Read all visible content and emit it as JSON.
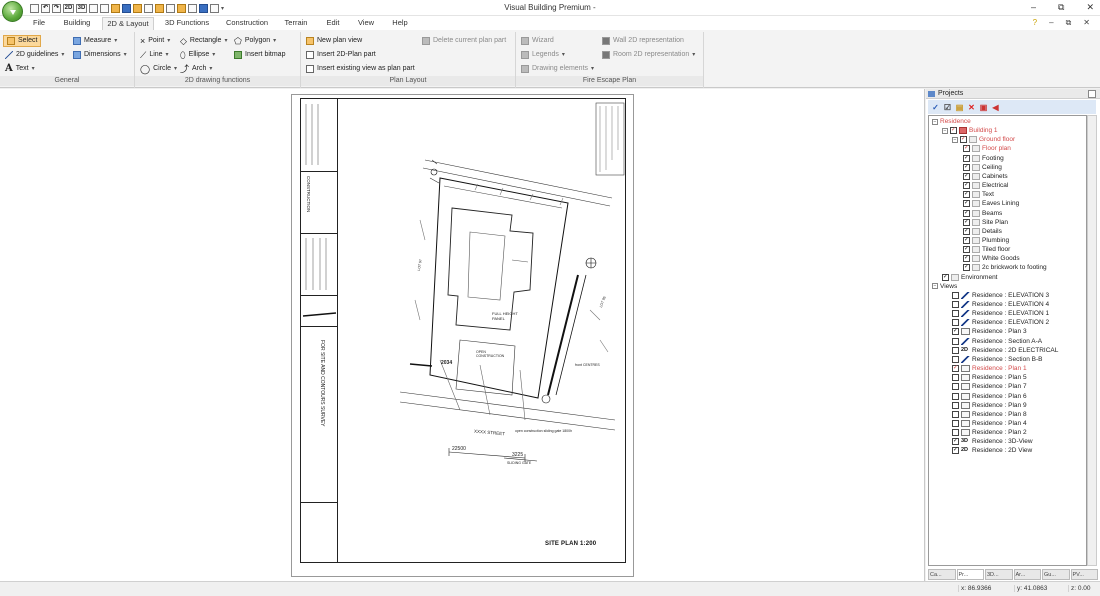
{
  "window": {
    "title": "Visual Building Premium -",
    "controls": [
      "–",
      "⧉",
      "✕"
    ]
  },
  "quick_access": [
    "2D",
    "3D"
  ],
  "menu": {
    "tabs": [
      "File",
      "Building",
      "2D & Layout",
      "3D Functions",
      "Construction",
      "Terrain",
      "Edit",
      "View",
      "Help"
    ],
    "active": "2D & Layout",
    "right_icons": [
      "?",
      "–",
      "⧉",
      "✕"
    ]
  },
  "ribbon": {
    "general": {
      "label": "General",
      "select": "Select",
      "guidelines": "2D guidelines",
      "text": "Text",
      "measure": "Measure",
      "dimensions": "Dimensions"
    },
    "drawing": {
      "label": "2D drawing functions",
      "point": "Point",
      "line": "Line",
      "circle": "Circle",
      "rectangle": "Rectangle",
      "ellipse": "Ellipse",
      "arch": "Arch",
      "polygon": "Polygon",
      "insert_bitmap": "Insert bitmap"
    },
    "plan_layout": {
      "label": "Plan Layout",
      "new_plan_view": "New plan view",
      "insert_2d_plan_part": "Insert 2D-Plan part",
      "insert_existing_view": "Insert existing view as plan part",
      "delete_current_plan_part": "Delete current plan part"
    },
    "fire_escape": {
      "label": "Fire Escape Plan",
      "wizard": "Wizard",
      "legends": "Legends",
      "drawing_elements": "Drawing elements",
      "wall_2d": "Wall 2D representation",
      "room_2d": "Room 2D representation"
    }
  },
  "drawing": {
    "site_plan_label": "SITE PLAN 1:200",
    "sidebar_text": "CONSTRUCTION",
    "contours_text": "FOR SITE AND CONTOURS SURVEY",
    "annotations": [
      "FULL HEIGHT PANEL",
      "OPEN CONSTRUCTION",
      "2034",
      "XXXX STREET",
      "22500",
      "3225",
      "SLIDING GATE",
      "open construction sliding gate 1800h",
      "front CENTRES",
      "LOT 97",
      "LOT 95"
    ]
  },
  "projects": {
    "title": "Projects",
    "tree": [
      {
        "level": 0,
        "label": "Residence",
        "expander": "minus",
        "checkbox": false,
        "red": true
      },
      {
        "level": 1,
        "label": "Building 1",
        "expander": "minus",
        "checkbox": true,
        "red": true
      },
      {
        "level": 2,
        "label": "Ground floor",
        "expander": "minus",
        "checkbox": true,
        "red": true
      },
      {
        "level": 3,
        "label": "Floor plan",
        "checkbox": true,
        "red": true
      },
      {
        "level": 3,
        "label": "Footing",
        "checkbox": true
      },
      {
        "level": 3,
        "label": "Ceiling",
        "checkbox": true
      },
      {
        "level": 3,
        "label": "Cabinets",
        "checkbox": true
      },
      {
        "level": 3,
        "label": "Electrical",
        "checkbox": true
      },
      {
        "level": 3,
        "label": "Text",
        "checkbox": true
      },
      {
        "level": 3,
        "label": "Eaves Lining",
        "checkbox": true
      },
      {
        "level": 3,
        "label": "Beams",
        "checkbox": true
      },
      {
        "level": 3,
        "label": "Site Plan",
        "checkbox": true
      },
      {
        "level": 3,
        "label": "Details",
        "checkbox": true
      },
      {
        "level": 3,
        "label": "Plumbing",
        "checkbox": true
      },
      {
        "level": 3,
        "label": "Tiled floor",
        "checkbox": true
      },
      {
        "level": 3,
        "label": "White Goods",
        "checkbox": true
      },
      {
        "level": 3,
        "label": "2c brickwork to footing",
        "checkbox": true
      },
      {
        "level": 1,
        "label": "Environment",
        "checkbox": true
      },
      {
        "level": 0,
        "label": "Views",
        "expander": "minus",
        "checkbox": false
      },
      {
        "level": 2,
        "label": "Residence : ELEVATION 3",
        "checkbox": false,
        "view": "el"
      },
      {
        "level": 2,
        "label": "Residence : ELEVATION 4",
        "checkbox": false,
        "view": "el"
      },
      {
        "level": 2,
        "label": "Residence : ELEVATION 1",
        "checkbox": false,
        "view": "el"
      },
      {
        "level": 2,
        "label": "Residence : ELEVATION 2",
        "checkbox": false,
        "view": "el"
      },
      {
        "level": 2,
        "label": "Residence : Plan 3",
        "checkbox": true,
        "view": "plan"
      },
      {
        "level": 2,
        "label": "Residence : Section A-A",
        "checkbox": false,
        "view": "el"
      },
      {
        "level": 2,
        "label": "Residence : 2D ELECTRICAL",
        "checkbox": false,
        "view": "2D"
      },
      {
        "level": 2,
        "label": "Residence : Section B-B",
        "checkbox": false,
        "view": "el"
      },
      {
        "level": 2,
        "label": "Residence : Plan 1",
        "checkbox": true,
        "view": "plan",
        "red": true
      },
      {
        "level": 2,
        "label": "Residence : Plan 5",
        "checkbox": false,
        "view": "plan"
      },
      {
        "level": 2,
        "label": "Residence : Plan 7",
        "checkbox": false,
        "view": "plan"
      },
      {
        "level": 2,
        "label": "Residence : Plan 6",
        "checkbox": false,
        "view": "plan"
      },
      {
        "level": 2,
        "label": "Residence : Plan 9",
        "checkbox": false,
        "view": "plan"
      },
      {
        "level": 2,
        "label": "Residence : Plan 8",
        "checkbox": false,
        "view": "plan"
      },
      {
        "level": 2,
        "label": "Residence : Plan 4",
        "checkbox": false,
        "view": "plan"
      },
      {
        "level": 2,
        "label": "Residence : Plan 2",
        "checkbox": false,
        "view": "plan"
      },
      {
        "level": 2,
        "label": "Residence : 3D-View",
        "checkbox": true,
        "view": "3D"
      },
      {
        "level": 2,
        "label": "Residence : 2D View",
        "checkbox": true,
        "view": "2D"
      }
    ],
    "bottom_tabs": [
      "Ca...",
      "Pr...",
      "3D...",
      "Ar...",
      "Gu...",
      "PV..."
    ]
  },
  "status": {
    "x": "x: 86.9366",
    "y": "y: 41.0863",
    "z": "z: 0.00"
  }
}
